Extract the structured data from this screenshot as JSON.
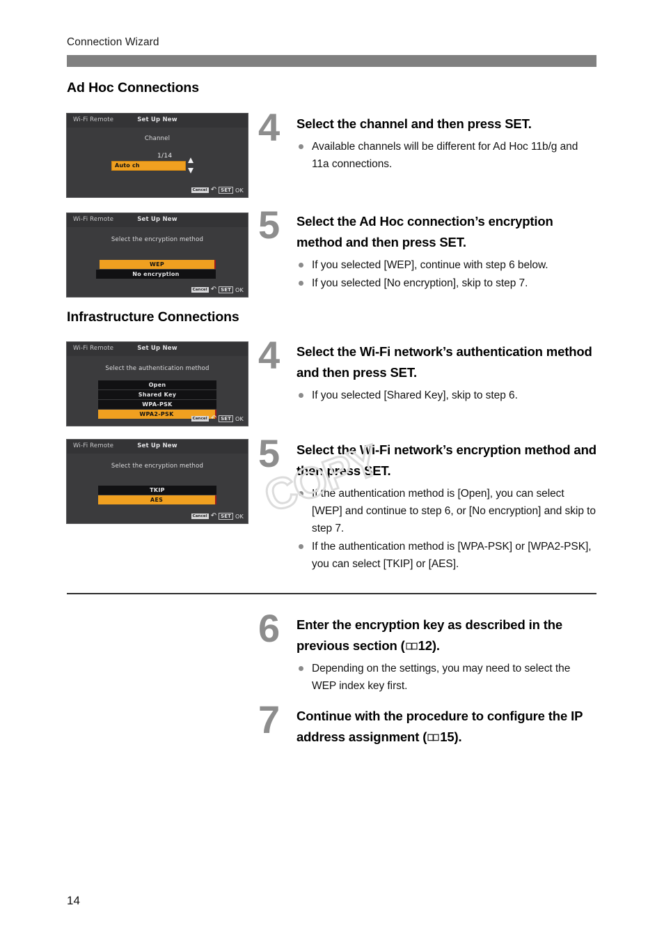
{
  "page": {
    "running_head": "Connection Wizard",
    "page_number": "14",
    "watermark": "COPY"
  },
  "sections": [
    {
      "id": "adhoc",
      "title": "Ad Hoc Connections"
    },
    {
      "id": "infra",
      "title": "Infrastructure Connections"
    }
  ],
  "screens": [
    {
      "id": "channel",
      "app_label": "Wi-Fi Remote",
      "mode_label": "Set Up New",
      "prompt": "Channel",
      "value": "Auto ch",
      "counter": "1/14",
      "footer": {
        "cancel": "Cancel",
        "set": "SET",
        "ok": "OK"
      }
    },
    {
      "id": "adhoc-encryption",
      "app_label": "Wi-Fi Remote",
      "mode_label": "Set Up New",
      "prompt": "Select the encryption method",
      "options": [
        {
          "label": "WEP",
          "selected": true
        },
        {
          "label": "No encryption",
          "selected": false
        }
      ],
      "footer": {
        "cancel": "Cancel",
        "set": "SET",
        "ok": "OK"
      }
    },
    {
      "id": "authentication",
      "app_label": "Wi-Fi Remote",
      "mode_label": "Set Up New",
      "prompt": "Select the authentication method",
      "options": [
        {
          "label": "Open",
          "selected": false
        },
        {
          "label": "Shared Key",
          "selected": false
        },
        {
          "label": "WPA-PSK",
          "selected": false
        },
        {
          "label": "WPA2-PSK",
          "selected": true
        }
      ],
      "footer": {
        "cancel": "Cancel",
        "set": "SET",
        "ok": "OK"
      }
    },
    {
      "id": "infra-encryption",
      "app_label": "Wi-Fi Remote",
      "mode_label": "Set Up New",
      "prompt": "Select the encryption method",
      "options": [
        {
          "label": "TKIP",
          "selected": false
        },
        {
          "label": "AES",
          "selected": true
        }
      ],
      "footer": {
        "cancel": "Cancel",
        "set": "SET",
        "ok": "OK"
      }
    }
  ],
  "steps": [
    {
      "id": "adhoc-step4",
      "number": "4",
      "title": "Select the channel and then press SET.",
      "bullets": [
        "Available channels will be different for Ad Hoc 11b/g and 11a connections."
      ]
    },
    {
      "id": "adhoc-step5",
      "number": "5",
      "title": "Select the Ad Hoc connection’s encryption method and then press SET.",
      "bullets": [
        "If you selected [WEP], continue with step 6 below.",
        "If you selected [No encryption], skip to step 7."
      ]
    },
    {
      "id": "infra-step4",
      "number": "4",
      "title": "Select the Wi-Fi network’s authentication method and then press SET.",
      "bullets": [
        "If you selected [Shared Key], skip to step 6."
      ]
    },
    {
      "id": "infra-step5",
      "number": "5",
      "title": "Select the Wi-Fi network’s encryption method and then press SET.",
      "bullets": [
        "If the authentication method is [Open], you can select [WEP] and continue to step 6, or [No encryption] and skip to step 7.",
        "If the authentication method is [WPA-PSK] or [WPA2-PSK], you can select [TKIP] or [AES]."
      ]
    },
    {
      "id": "step6",
      "number": "6",
      "title_before_ref": "Enter the encryption key as described in the previous section (",
      "ref_page": "12",
      "title_after_ref": ").",
      "bullets": [
        "Depending on the settings, you may need to select the WEP index key first."
      ]
    },
    {
      "id": "step7",
      "number": "7",
      "title_before_ref": "Continue with the procedure to configure the IP address assignment (",
      "ref_page": "15",
      "title_after_ref": ").",
      "bullets": []
    }
  ],
  "colors": {
    "header_bar": "#808080",
    "step_number": "#8d8d8d",
    "lcd_background": "#3b3b3d",
    "lcd_selected": "#f0a020",
    "bullet": "#8a8a8a"
  }
}
